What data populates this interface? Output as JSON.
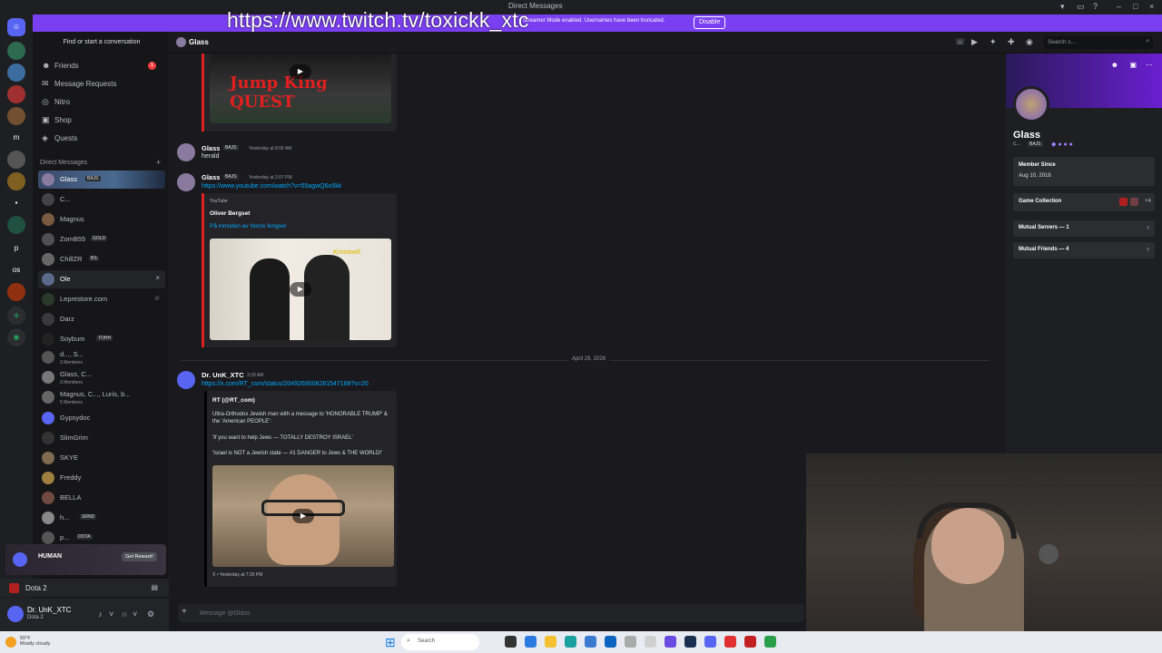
{
  "window": {
    "title": "Direct Messages"
  },
  "banner": {
    "message": "Streamer Mode enabled. Usernames have been truncated.",
    "disable_label": "Disable",
    "overlay_url": "https://www.twitch.tv/toxickk_xtc"
  },
  "sidebar": {
    "search_label": "Find or start a conversation",
    "nav": [
      {
        "label": "Friends",
        "icon": "friends-icon",
        "badge": "1"
      },
      {
        "label": "Message Requests",
        "icon": "mail-icon"
      },
      {
        "label": "Nitro",
        "icon": "nitro-icon"
      },
      {
        "label": "Shop",
        "icon": "shop-icon"
      },
      {
        "label": "Quests",
        "icon": "quests-icon"
      }
    ],
    "dm_header": "Direct Messages",
    "dms": [
      {
        "name": "Glass",
        "tag": "BAJS",
        "selected": true
      },
      {
        "name": "C..."
      },
      {
        "name": "Magnus"
      },
      {
        "name": "ZomB55",
        "tag": "GOLD"
      },
      {
        "name": "ChillZR",
        "tag": "BS"
      },
      {
        "name": "Ole",
        "hover": true
      },
      {
        "name": "Leprestore.com"
      },
      {
        "name": "Darz"
      },
      {
        "name": "Soybum",
        "tag": "TOHH"
      },
      {
        "name": "d..., S...",
        "sub": "3 Members"
      },
      {
        "name": "Glass, C...",
        "sub": "3 Members"
      },
      {
        "name": "Magnus, C..., Luris, b...",
        "sub": "5 Members"
      },
      {
        "name": "Gypsydoc"
      },
      {
        "name": "SlimGrim"
      },
      {
        "name": "SKYE"
      },
      {
        "name": "Freddy"
      },
      {
        "name": "BELLA"
      },
      {
        "name": "h...",
        "tag": "SRND"
      },
      {
        "name": "p...",
        "tag": "DOTA"
      }
    ],
    "quest": {
      "title": "HUMAN",
      "reward": "Get Reward!"
    },
    "activity": "Dota 2",
    "user": {
      "name": "Dr. UnK_XTC",
      "status": "Dota 2"
    }
  },
  "header": {
    "channel": "Glass",
    "search_placeholder": "Search c..."
  },
  "messages": {
    "m1": {
      "author": "Glass",
      "tag": "BAJS",
      "time": "Yesterday at 8:06 AM",
      "text": "herald"
    },
    "m2": {
      "author": "Glass",
      "tag": "BAJS",
      "time": "Yesterday at 2:07 PM",
      "link": "https://www.youtube.com/watch?v=55agwQ6o5kk",
      "embed_provider": "YouTube",
      "embed_author": "Oliver Bergset",
      "embed_title": "På innsiden av Norsk fengsel",
      "thumb_caption": "Kriminell"
    },
    "top_thumb_text": "Jump King QUEST",
    "date_divider": "April 29, 2026",
    "m3": {
      "author": "Dr. UnK_XTC",
      "time": "3:39 AM",
      "link": "https://x.com/RT_com/status/2049269008281547188?s=20",
      "embed_author": "RT (@RT_com)",
      "line1": "Ultra-Orthodox Jewish man with a message to 'HONORABLE TRUMP' & the 'American PEOPLE':",
      "line2": "'If you want to help Jews — TOTALLY DESTROY ISRAEL'",
      "line3": "'Israel is NOT a Jewish state — #1 DANGER to Jews & THE WORLD!'",
      "footer": "X • Yesterday at 7:26 PM"
    }
  },
  "composer": {
    "placeholder": "Message @Glass"
  },
  "profile": {
    "name": "Glass",
    "sub": "c...",
    "tag": "BAJS",
    "member_since_label": "Member Since",
    "member_since": "Aug 10, 2016",
    "game_collection": "Game Collection",
    "game_more": "+4",
    "mutual_servers": "Mutual Servers — 1",
    "mutual_friends": "Mutual Friends — 4"
  },
  "taskbar": {
    "weather_temp": "50°F",
    "weather_desc": "Mostly cloudy",
    "search": "Search"
  },
  "colors": {
    "accent": "#7b3ff2",
    "link": "#00a8fc",
    "embed_bar": "#e02020",
    "background": "#1a1a1e"
  }
}
